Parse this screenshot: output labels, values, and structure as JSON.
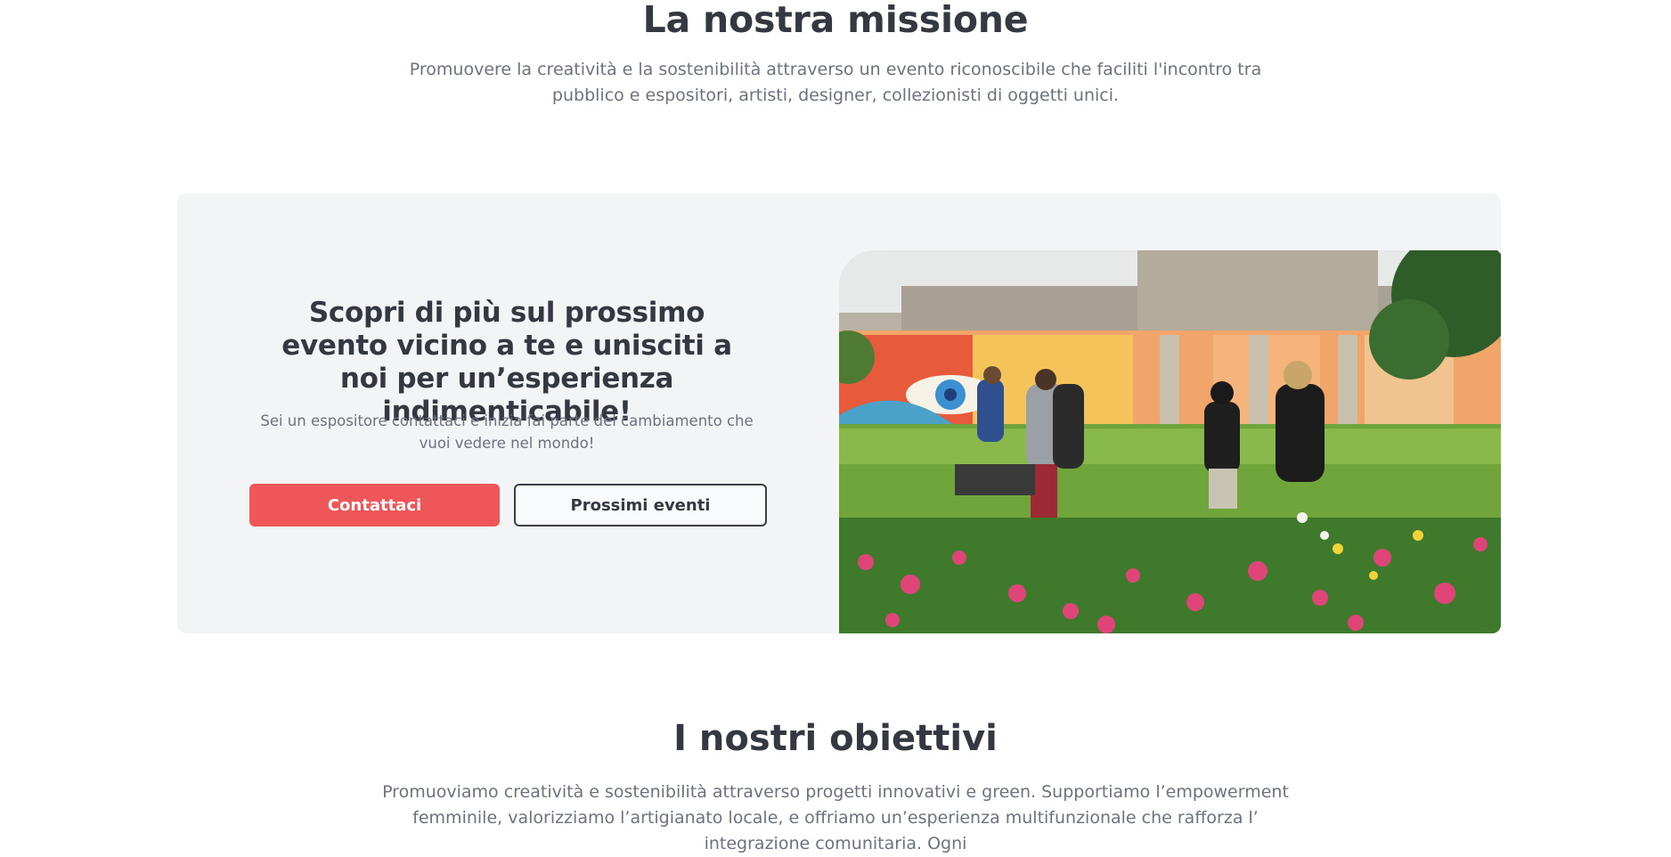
{
  "mission": {
    "title": "La nostra missione",
    "text": "Promuovere la creatività e la sostenibilità attraverso un evento riconoscibile che faciliti l'incontro tra pubblico e espositori, artisti, designer, collezionisti di oggetti unici."
  },
  "cta": {
    "title": "Scopri di più sul prossimo evento vicino a te e unisciti a noi per un’esperienza indimenticabile!",
    "subtitle": "Sei un espositore contattaci e inizia fai parte del cambiamento che vuoi vedere nel mondo!",
    "primary_button": "Contattaci",
    "secondary_button": "Prossimi eventi",
    "colors": {
      "accent": "#ef5659",
      "card_bg": "#f3f4f6",
      "text_dark": "#333841"
    }
  },
  "objectives": {
    "title": "I nostri obiettivi",
    "text": "Promuoviamo creatività e sostenibilità attraverso progetti innovativi e green. Supportiamo l’empowerment femminile, valorizziamo l’artigianato locale, e offriamo un’esperienza multifunzionale che rafforza l’ integrazione comunitaria. Ogni"
  }
}
